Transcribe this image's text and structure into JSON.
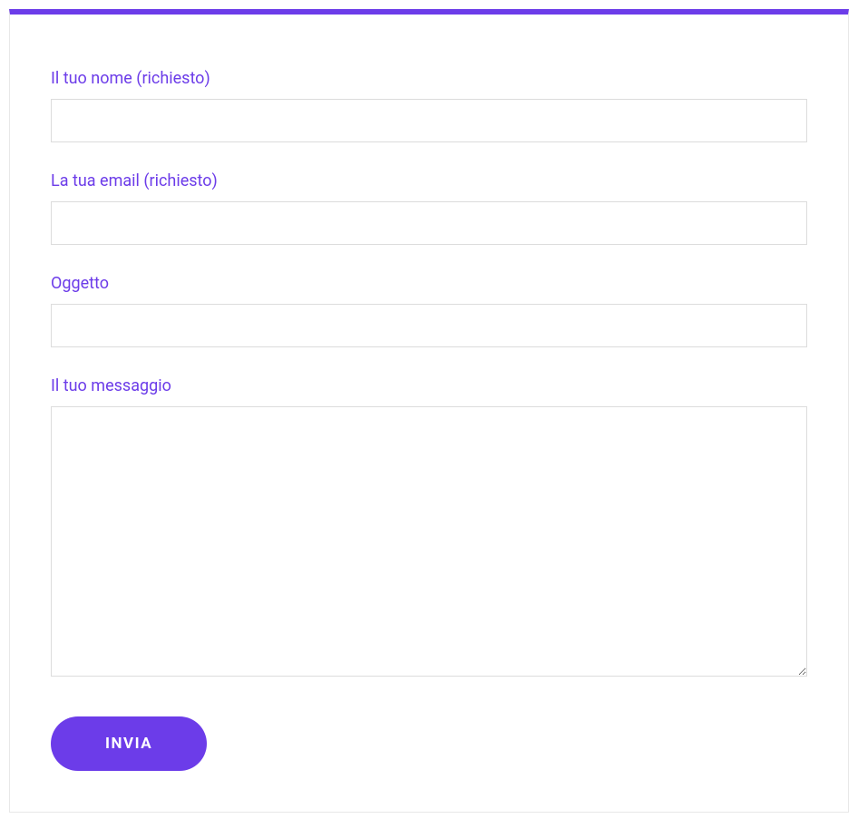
{
  "form": {
    "fields": {
      "name": {
        "label": "Il tuo nome (richiesto)",
        "value": ""
      },
      "email": {
        "label": "La tua email (richiesto)",
        "value": ""
      },
      "subject": {
        "label": "Oggetto",
        "value": ""
      },
      "message": {
        "label": "Il tuo messaggio",
        "value": ""
      }
    },
    "submit_label": "INVIA"
  },
  "colors": {
    "accent": "#6c3ce9",
    "border": "#dcdcdc",
    "container_border": "#e8e8e8"
  }
}
